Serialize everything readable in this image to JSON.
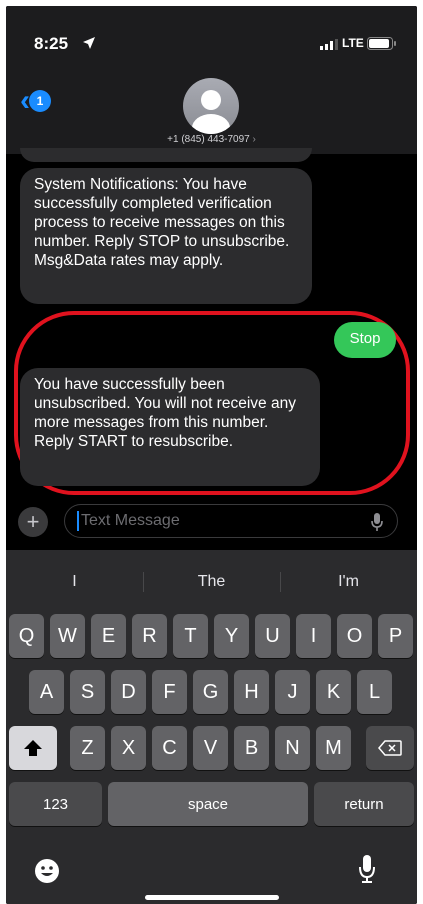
{
  "status_bar": {
    "time": "8:25",
    "network": "LTE"
  },
  "header": {
    "back_badge": "1",
    "contact": "+1 (845) 443-7097",
    "contact_chevron": "›"
  },
  "messages": [
    {
      "direction": "incoming",
      "text": "System Notifications: You have successfully completed verification process to receive messages on this number. Reply STOP to unsubscribe. Msg&Data rates may apply."
    },
    {
      "direction": "outgoing",
      "text": "Stop"
    },
    {
      "direction": "incoming",
      "text": "You have successfully been unsubscribed. You will not receive any more messages from this number. Reply START to resubscribe."
    }
  ],
  "compose": {
    "plus": "+",
    "placeholder": "Text Message"
  },
  "keyboard": {
    "suggestions": [
      "I",
      "The",
      "I'm"
    ],
    "row1": [
      "Q",
      "W",
      "E",
      "R",
      "T",
      "Y",
      "U",
      "I",
      "O",
      "P"
    ],
    "row2": [
      "A",
      "S",
      "D",
      "F",
      "G",
      "H",
      "J",
      "K",
      "L"
    ],
    "row3": [
      "Z",
      "X",
      "C",
      "V",
      "B",
      "N",
      "M"
    ],
    "numbers": "123",
    "space": "space",
    "return": "return"
  },
  "icons": [
    "location-arrow-icon",
    "signal-icon",
    "battery-icon",
    "back-chevron-icon",
    "person-icon",
    "mic-icon",
    "shift-icon",
    "delete-icon",
    "emoji-icon",
    "dictation-icon"
  ],
  "colors": {
    "accent": "#1a8cff",
    "outgoing": "#34c759",
    "incoming": "#2c2c2e",
    "highlight": "#e0121e"
  }
}
